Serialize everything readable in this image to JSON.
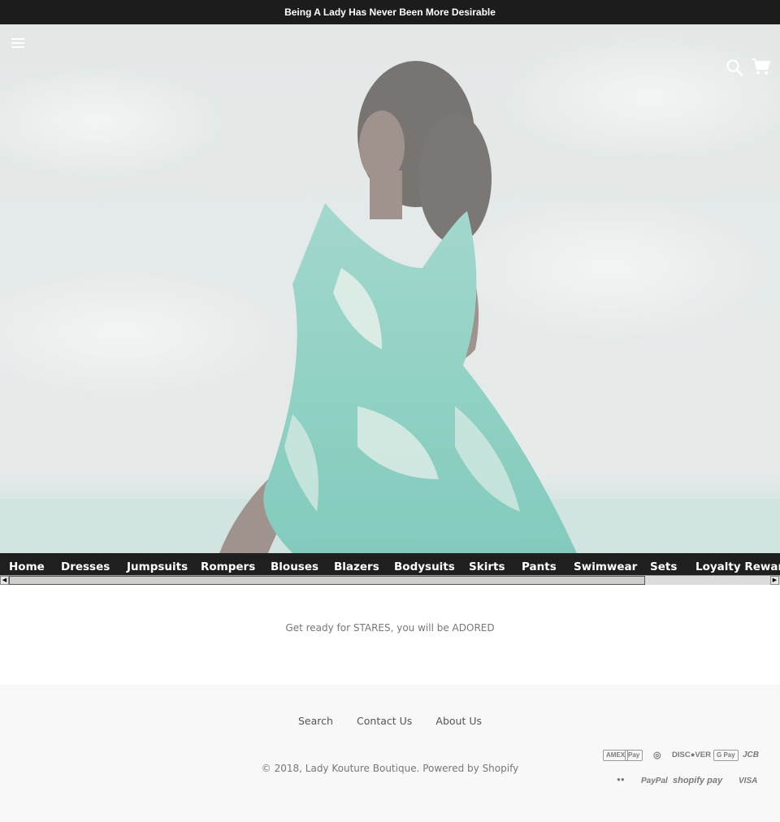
{
  "announcement": {
    "text": "Being A Lady Has Never Been More Desirable"
  },
  "header": {
    "menu_icon": "hamburger-menu-icon",
    "search_icon": "search-icon",
    "cart_icon": "cart-icon"
  },
  "hero": {
    "image": "woman in green palm-print ruffled dress by the sea"
  },
  "nav": {
    "items": [
      {
        "label": "Home"
      },
      {
        "label": "Dresses"
      },
      {
        "label": "Jumpsuits"
      },
      {
        "label": "Rompers"
      },
      {
        "label": "Blouses"
      },
      {
        "label": "Blazers"
      },
      {
        "label": "Bodysuits"
      },
      {
        "label": "Skirts"
      },
      {
        "label": "Pants"
      },
      {
        "label": "Swimwear"
      },
      {
        "label": "Sets"
      },
      {
        "label": "Loyalty Rewards"
      }
    ]
  },
  "tagline": "Get ready for STARES, you will be ADORED",
  "footer": {
    "links": [
      {
        "label": "Search"
      },
      {
        "label": "Contact Us"
      },
      {
        "label": "About Us"
      }
    ],
    "copyright": "© 2018, Lady Kouture Boutique. Powered by Shopify",
    "payments": {
      "amex": "AMEX",
      "apple_pay": " Pay",
      "diners": "◎",
      "discover": "DISC●VER",
      "google_pay": "G Pay",
      "jcb": "JCB",
      "master": "●●",
      "paypal": "PayPal",
      "shopify_pay": "shopify pay",
      "visa": "VISA"
    }
  }
}
